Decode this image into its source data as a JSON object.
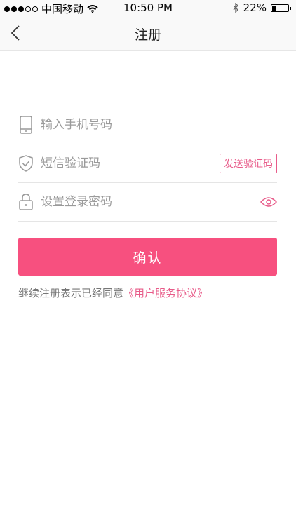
{
  "status_bar": {
    "carrier": "中国移动",
    "time": "10:50 PM",
    "battery": "22%",
    "battery_level": 0.22,
    "signal_bars": 3,
    "signal_total": 5
  },
  "nav": {
    "title": "注册",
    "back_icon": "chevron-left-icon"
  },
  "form": {
    "phone": {
      "placeholder": "输入手机号码",
      "value": "",
      "icon": "phone-icon"
    },
    "sms": {
      "placeholder": "短信验证码",
      "value": "",
      "icon": "shield-check-icon",
      "button_label": "发送验证码"
    },
    "password": {
      "placeholder": "设置登录密码",
      "value": "",
      "icon": "lock-icon",
      "toggle_icon": "eye-icon"
    }
  },
  "confirm_label": "确认",
  "agreement": {
    "text": "继续注册表示已经同意",
    "link": "《用户服务协议》"
  },
  "colors": {
    "accent": "#f7507f",
    "link": "#e85c8a",
    "placeholder": "#9a9a9a",
    "divider": "#e5e5e5"
  }
}
